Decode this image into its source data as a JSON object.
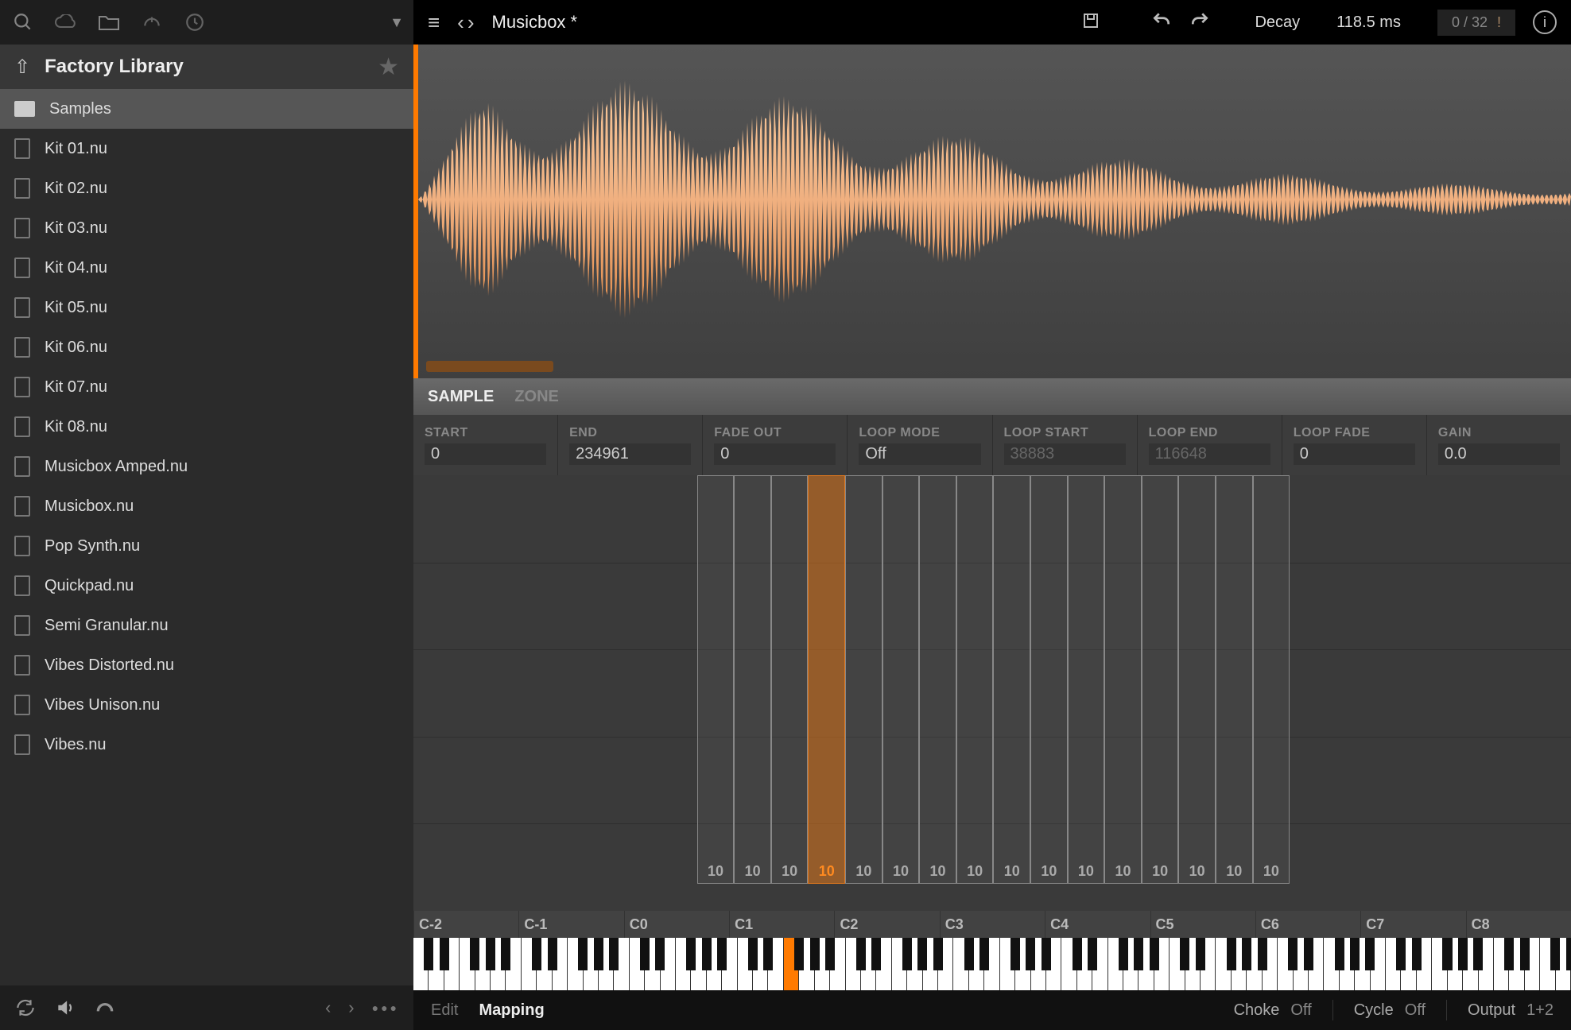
{
  "sidebar": {
    "title": "Factory Library",
    "folder": "Samples",
    "files": [
      "Kit 01.nu",
      "Kit 02.nu",
      "Kit 03.nu",
      "Kit 04.nu",
      "Kit 05.nu",
      "Kit 06.nu",
      "Kit 07.nu",
      "Kit 08.nu",
      "Musicbox Amped.nu",
      "Musicbox.nu",
      "Pop Synth.nu",
      "Quickpad.nu",
      "Semi Granular.nu",
      "Vibes Distorted.nu",
      "Vibes Unison.nu",
      "Vibes.nu"
    ]
  },
  "topbar": {
    "preset": "Musicbox *",
    "param_label": "Decay",
    "param_value": "118.5 ms",
    "voices": "0 / 32",
    "voices_warn": "!"
  },
  "tabs": {
    "sample": "SAMPLE",
    "zone": "ZONE"
  },
  "params": [
    {
      "label": "START",
      "value": "0",
      "dim": false
    },
    {
      "label": "END",
      "value": "234961",
      "dim": false
    },
    {
      "label": "FADE OUT",
      "value": "0",
      "dim": false
    },
    {
      "label": "LOOP MODE",
      "value": "Off",
      "dim": false
    },
    {
      "label": "LOOP START",
      "value": "38883",
      "dim": true
    },
    {
      "label": "LOOP END",
      "value": "116648",
      "dim": true
    },
    {
      "label": "LOOP FADE",
      "value": "0",
      "dim": false
    },
    {
      "label": "GAIN",
      "value": "0.0",
      "dim": false
    }
  ],
  "zones": {
    "count": 16,
    "selected_index": 3,
    "label": "10"
  },
  "noteruler": [
    "C-2",
    "C-1",
    "C0",
    "C1",
    "C2",
    "C3",
    "C4",
    "C5",
    "C6",
    "C7",
    "C8"
  ],
  "footer": {
    "edit": "Edit",
    "mapping": "Mapping",
    "choke_l": "Choke",
    "choke_v": "Off",
    "cycle_l": "Cycle",
    "cycle_v": "Off",
    "output_l": "Output",
    "output_v": "1+2"
  }
}
